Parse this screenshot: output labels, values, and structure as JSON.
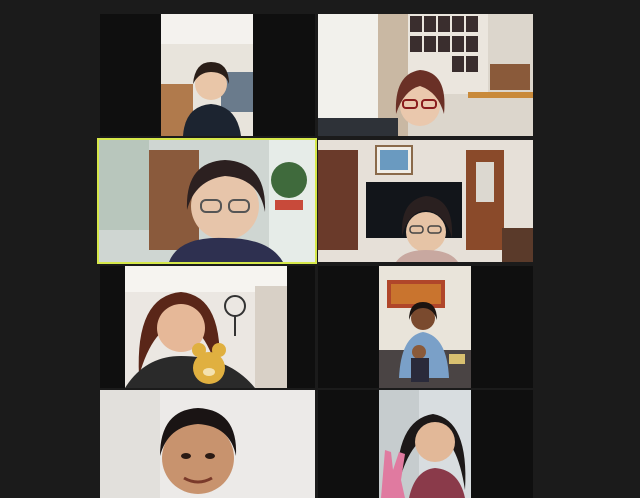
{
  "app": {
    "view": "gallery",
    "active_speaker_color": "#d6e84a",
    "background_color": "#1b1b1b"
  },
  "participants": [
    {
      "id": "p1",
      "scene": "living-room-left",
      "active": false
    },
    {
      "id": "p2",
      "scene": "kitchen-posters",
      "active": false
    },
    {
      "id": "p3",
      "scene": "window-plant",
      "active": true
    },
    {
      "id": "p4",
      "scene": "tv-room",
      "active": false
    },
    {
      "id": "p5",
      "scene": "room-with-fan-teddy-bear",
      "active": false
    },
    {
      "id": "p6",
      "scene": "sofa-with-child",
      "active": false
    },
    {
      "id": "p7",
      "scene": "plain-wall",
      "active": false
    },
    {
      "id": "p8",
      "scene": "outdoor-peace-sign",
      "active": false
    }
  ]
}
